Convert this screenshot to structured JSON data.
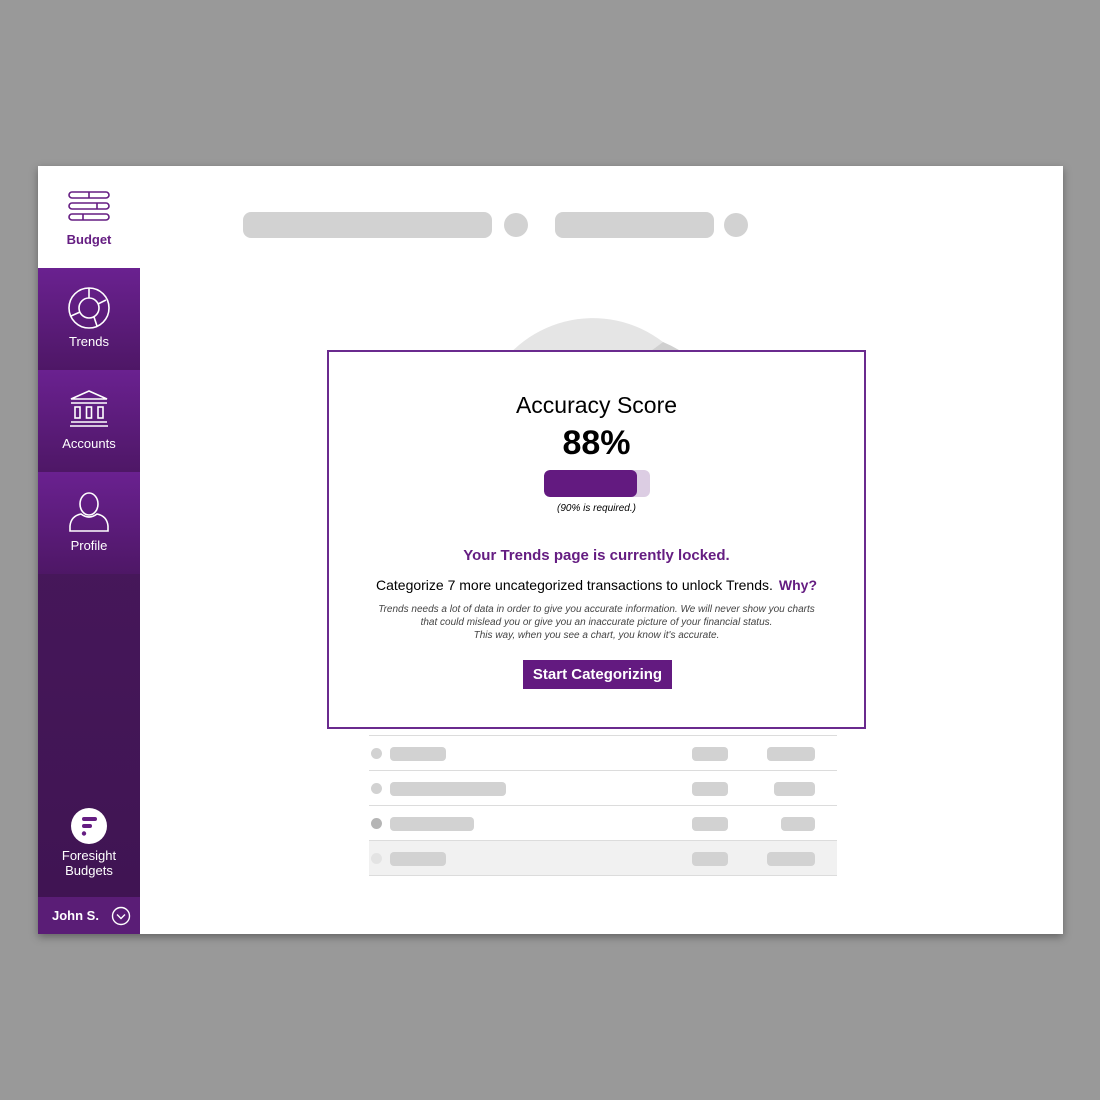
{
  "sidebar": {
    "items": [
      {
        "label": "Budget",
        "icon": "budget-sliders-icon",
        "active": true
      },
      {
        "label": "Trends",
        "icon": "donut-chart-icon"
      },
      {
        "label": "Accounts",
        "icon": "bank-icon"
      },
      {
        "label": "Profile",
        "icon": "person-icon"
      }
    ],
    "brand": {
      "line1": "Foresight",
      "line2": "Budgets",
      "logo": "foresight-logo"
    },
    "user": {
      "name": "John S.",
      "icon": "chevron-down-circle-icon"
    }
  },
  "modal": {
    "title": "Accuracy Score",
    "score": "88%",
    "score_fraction": 0.88,
    "required_note": "(90% is required.)",
    "locked_message": "Your Trends page is currently locked.",
    "instruction": "Categorize 7 more uncategorized transactions to unlock Trends.",
    "why_link": "Why?",
    "explanation": [
      "Trends needs a lot of data in order to give you accurate information. We will never show you charts",
      "that could mislead you or give you an inaccurate picture of your financial status.",
      "This way, when you see a chart, you know it's accurate."
    ],
    "button": "Start Categorizing"
  },
  "colors": {
    "brand_purple": "#651d82",
    "sidebar_dark": "#4d1a62",
    "placeholder": "#d2d2d2",
    "backdrop": "#999999"
  }
}
